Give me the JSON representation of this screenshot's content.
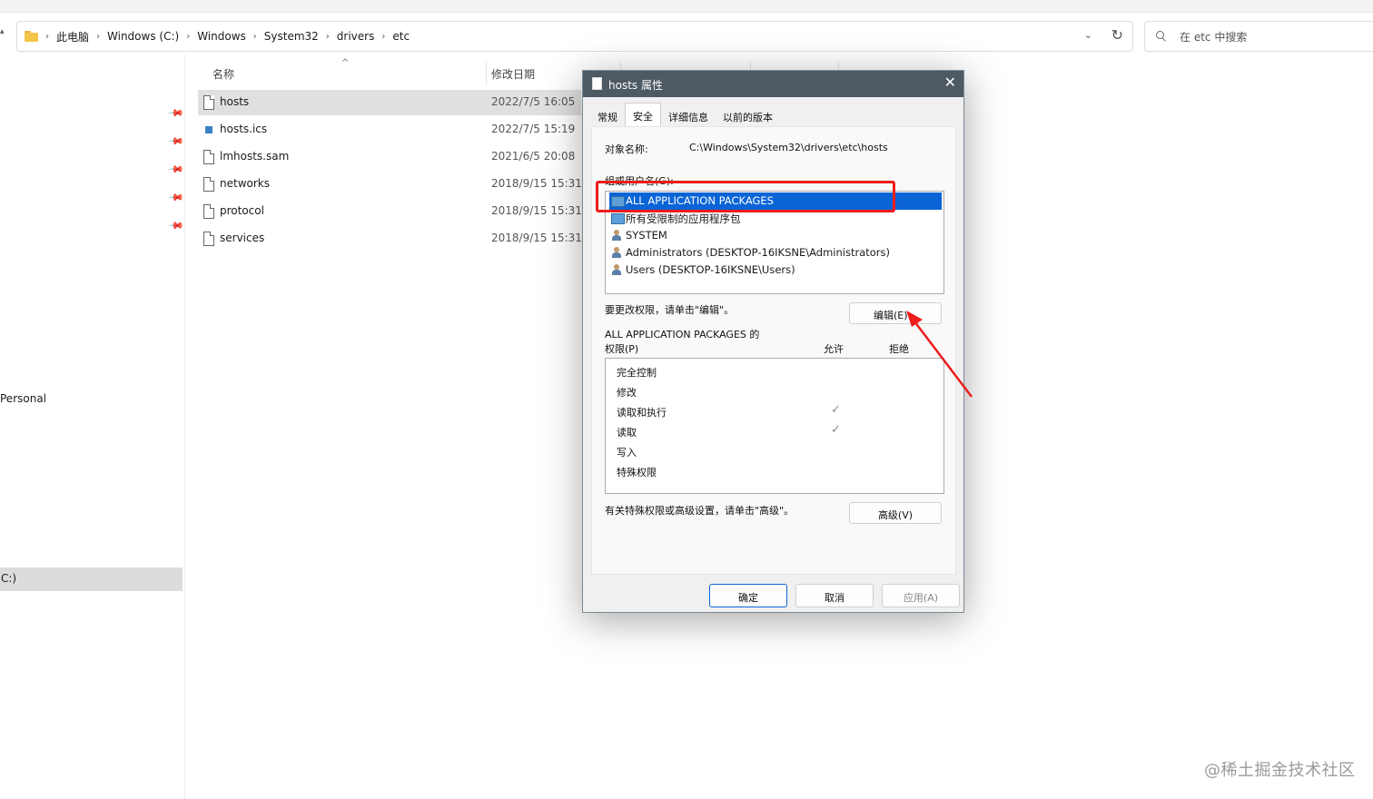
{
  "explorer": {
    "breadcrumbs": [
      "此电脑",
      "Windows (C:)",
      "Windows",
      "System32",
      "drivers",
      "etc"
    ],
    "search_placeholder": "在 etc 中搜索",
    "columns": {
      "name": "名称",
      "date": "修改日期"
    },
    "files": [
      {
        "name": "hosts",
        "date": "2022/7/5 16:05",
        "selected": true,
        "icon": "file-icon"
      },
      {
        "name": "hosts.ics",
        "date": "2022/7/5 15:19",
        "selected": false,
        "icon": "ics-file-icon"
      },
      {
        "name": "lmhosts.sam",
        "date": "2021/6/5 20:08",
        "selected": false,
        "icon": "file-icon"
      },
      {
        "name": "networks",
        "date": "2018/9/15 15:31",
        "selected": false,
        "icon": "file-icon"
      },
      {
        "name": "protocol",
        "date": "2018/9/15 15:31",
        "selected": false,
        "icon": "file-icon"
      },
      {
        "name": "services",
        "date": "2018/9/15 15:31",
        "selected": false,
        "icon": "file-icon"
      }
    ],
    "nav": {
      "personal": "Personal",
      "drive": "C:)"
    }
  },
  "dialog": {
    "title": "hosts 属性",
    "tabs": [
      "常规",
      "安全",
      "详细信息",
      "以前的版本"
    ],
    "active_tab": "安全",
    "object_name_label": "对象名称:",
    "object_name_value": "C:\\Windows\\System32\\drivers\\etc\\hosts",
    "groups_label": "组或用户名(G):",
    "groups": [
      {
        "name": "ALL APPLICATION PACKAGES",
        "selected": true,
        "icon": "group-icon"
      },
      {
        "name": "所有受限制的应用程序包",
        "selected": false,
        "icon": "group-icon"
      },
      {
        "name": "SYSTEM",
        "selected": false,
        "icon": "users-icon"
      },
      {
        "name": "Administrators (DESKTOP-16IKSNE\\Administrators)",
        "selected": false,
        "icon": "users-icon"
      },
      {
        "name": "Users (DESKTOP-16IKSNE\\Users)",
        "selected": false,
        "icon": "users-icon"
      }
    ],
    "edit_hint": "要更改权限，请单击\"编辑\"。",
    "edit_button": "编辑(E)...",
    "perm_label_line1": "ALL APPLICATION PACKAGES 的",
    "perm_label_line2": "权限(P)",
    "allow_header": "允许",
    "deny_header": "拒绝",
    "permissions": [
      {
        "name": "完全控制",
        "allow": false
      },
      {
        "name": "修改",
        "allow": false
      },
      {
        "name": "读取和执行",
        "allow": true
      },
      {
        "name": "读取",
        "allow": true
      },
      {
        "name": "写入",
        "allow": false
      },
      {
        "name": "特殊权限",
        "allow": false
      }
    ],
    "advanced_hint": "有关特殊权限或高级设置，请单击\"高级\"。",
    "advanced_button": "高级(V)",
    "ok_button": "确定",
    "cancel_button": "取消",
    "apply_button": "应用(A)"
  },
  "watermark": "@稀土掘金技术社区",
  "colors": {
    "selection": "#0a64d6",
    "annotation_red": "#ee1c1c",
    "titlebar": "#4d5a64"
  }
}
